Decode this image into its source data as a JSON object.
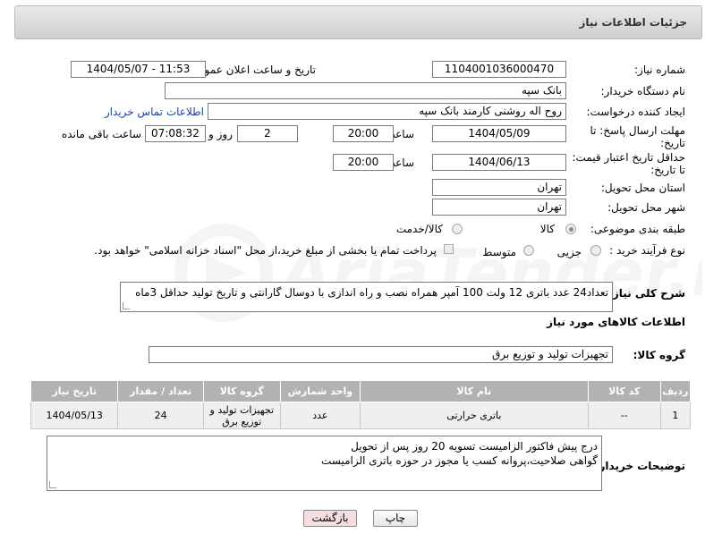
{
  "header": {
    "title": "جزئیات اطلاعات نیاز"
  },
  "form": {
    "need_number_label": "شماره نیاز:",
    "need_number_value": "1104001036000470",
    "announce_label": "تاریخ و ساعت اعلان عمومی:",
    "announce_value": "1404/05/07 - 11:53",
    "buyer_org_label": "نام دستگاه خریدار:",
    "buyer_org_value": "بانک سپه",
    "creator_label": "ایجاد کننده درخواست:",
    "creator_value": "روح اله روشنی کارمند بانک سپه",
    "contact_link": "اطلاعات تماس خریدار",
    "deadline_label_1": "مهلت ارسال پاسخ: تا",
    "deadline_label_2": "تاریخ:",
    "deadline_date": "1404/05/09",
    "time_label": "ساعت",
    "deadline_time": "20:00",
    "days_value": "2",
    "days_label": "روز و",
    "remaining_time": "07:08:32",
    "remaining_label": "ساعت باقی مانده",
    "price_validity_label_1": "حداقل تاریخ اعتبار قیمت:",
    "price_validity_label_2": "تا تاریخ:",
    "price_validity_date": "1404/06/13",
    "price_validity_time": "20:00",
    "province_label": "استان محل تحویل:",
    "province_value": "تهران",
    "city_label": "شهر محل تحویل:",
    "city_value": "تهران",
    "category_label": "طبقه بندی موضوعی:",
    "category_options": [
      "کالا",
      "کالا/خدمت"
    ],
    "process_label": "نوع فرآیند خرید :",
    "process_options": [
      "جزیی",
      "متوسط"
    ],
    "payment_note": "پرداخت تمام یا بخشی از مبلغ خرید،از محل \"اسناد خزانه اسلامی\" خواهد بود."
  },
  "description": {
    "label": "شرح کلی نیاز:",
    "value": "تعداد24 عدد باتری 12 ولت 100 آمپر همراه نصب و راه اندازی با دوسال گارانتی و تاریخ تولید حداقل 3ماه"
  },
  "goods": {
    "section_title": "اطلاعات کالاهای مورد نیاز",
    "group_label": "گروه کالا:",
    "group_value": "تجهیزات تولید و توزیع برق",
    "columns": [
      "ردیف",
      "کد کالا",
      "نام کالا",
      "واحد شمارش",
      "گروه کالا",
      "تعداد / مقدار",
      "تاریخ نیاز"
    ],
    "rows": [
      [
        "1",
        "--",
        "باتری حرارتی",
        "عدد",
        "تجهیزات تولید و توزیع برق",
        "24",
        "1404/05/13"
      ]
    ]
  },
  "buyer_notes": {
    "label": "توضیحات خریدار:",
    "line1": "درج پیش فاکتور الزامیست تسویه 20 روز پس از تحویل",
    "line2": "گواهی صلاحیت،پروانه کسب یا مجوز در حوزه باتری الزامیست"
  },
  "buttons": {
    "print": "چاپ",
    "back": "بازگشت"
  },
  "colors": {
    "back_button_bg": "#f6dede",
    "link": "#1a44a6",
    "table_header": "#b2b2b2"
  }
}
